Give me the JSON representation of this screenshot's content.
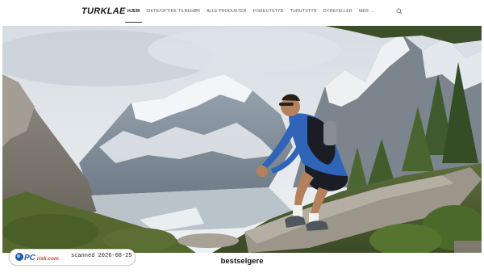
{
  "header": {
    "logo": "TURKLAE",
    "nav": [
      "HJEM",
      "SIKTE/OPTIKK TILBEHØR",
      "ALLE PRODUKTER",
      "FISKEUTSTYR",
      "TURUTSTYR",
      "DYREFELLER",
      "MER"
    ],
    "active_index": 0
  },
  "watermark": {
    "brand": "PC",
    "brand_suffix": "risk.com",
    "text": "scanned 2026-08-25"
  },
  "section": {
    "title": "bestselgere"
  },
  "colors": {
    "accent": "#1f5fa8"
  }
}
